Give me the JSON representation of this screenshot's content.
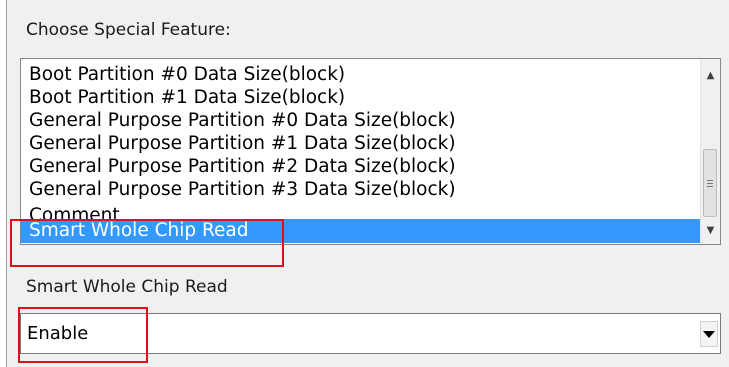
{
  "special_feature": {
    "label": "Choose Special Feature:",
    "items": [
      "Boot Partition #0 Data Size(block)",
      "Boot Partition #1 Data Size(block)",
      "General Purpose Partition #0 Data Size(block)",
      "General Purpose Partition #1 Data Size(block)",
      "General Purpose Partition #2 Data Size(block)",
      "General Purpose Partition #3 Data Size(block)",
      "Comment",
      "Smart Whole Chip Read"
    ],
    "selected": "Smart Whole Chip Read"
  },
  "smart_read": {
    "label": "Smart Whole Chip Read",
    "value": "Enable"
  },
  "icons": {
    "scroll_up": "triangle-up-icon",
    "scroll_down": "triangle-down-icon",
    "dropdown": "chevron-down-icon"
  },
  "colors": {
    "selection": "#3399ff",
    "annotation": "#e0101a"
  }
}
